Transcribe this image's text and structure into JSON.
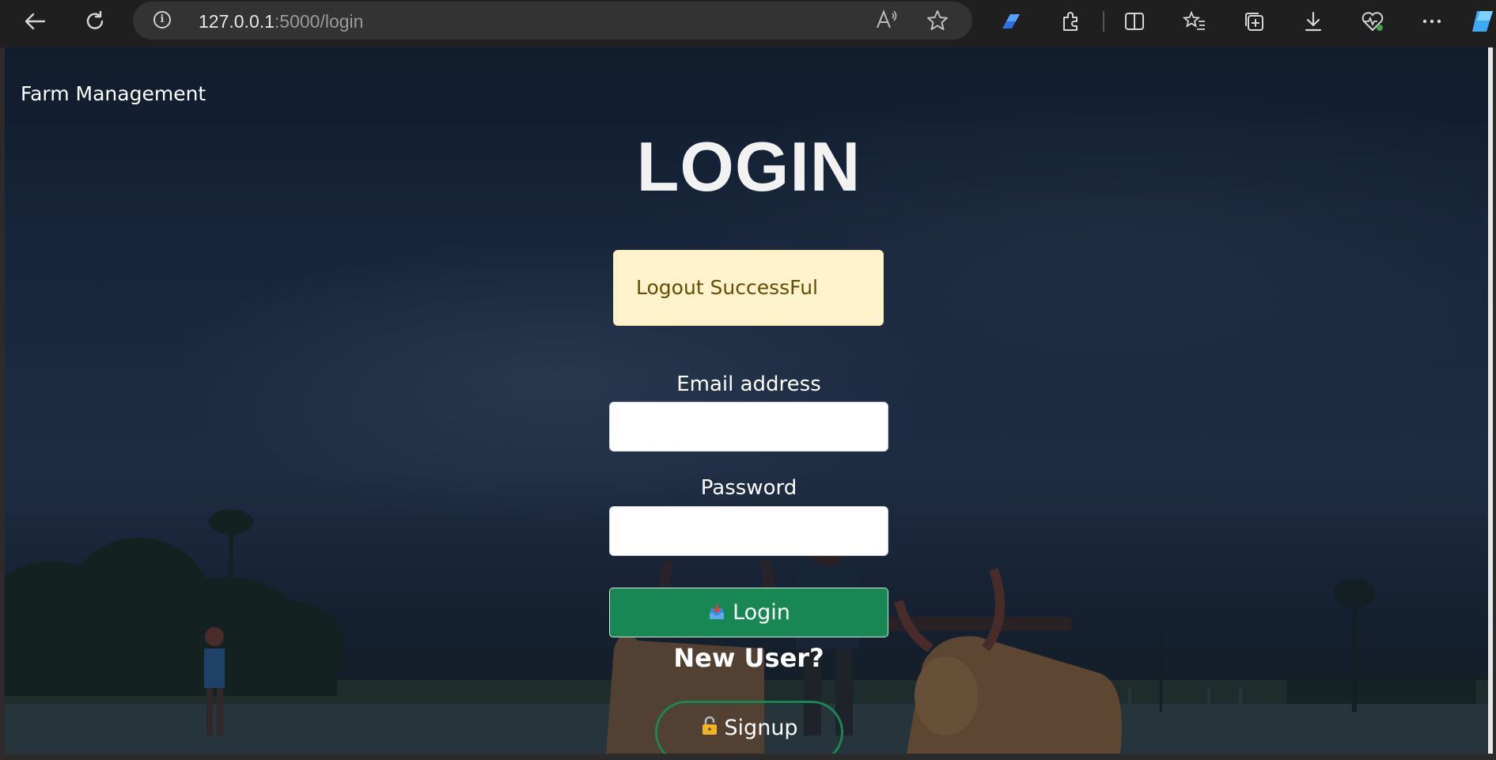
{
  "browser": {
    "url_host": "127.0.0.1",
    "url_path": ":5000/login"
  },
  "page": {
    "brand": "Farm Management",
    "title": "LOGIN",
    "alert": "Logout SuccessFul",
    "email_label": "Email address",
    "email_value": "",
    "password_label": "Password",
    "password_value": "",
    "login_button": "Login",
    "new_user": "New User?",
    "signup_button": "Signup"
  },
  "colors": {
    "accent": "#198754",
    "alert_bg": "#fff3cd",
    "alert_text": "#664d03"
  },
  "icons": {
    "login": "inbox-tray-icon",
    "signup": "lock-icon"
  }
}
